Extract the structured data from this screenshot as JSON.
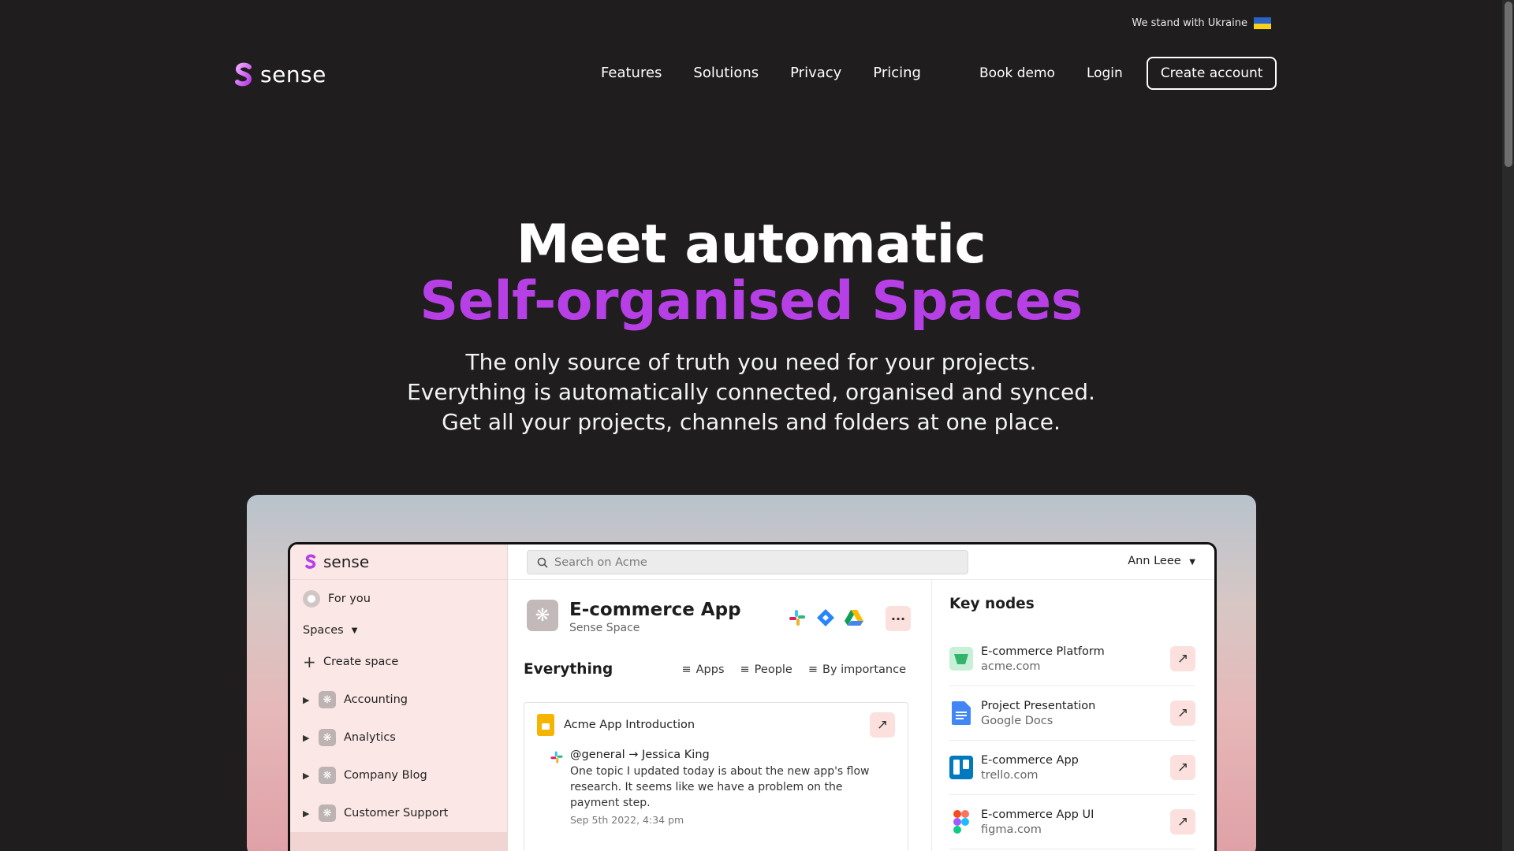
{
  "banner": {
    "text": "We stand with Ukraine"
  },
  "brand": {
    "name": "sense"
  },
  "nav": {
    "items": [
      "Features",
      "Solutions",
      "Privacy",
      "Pricing"
    ],
    "book_demo": "Book demo",
    "login": "Login",
    "create_account": "Create account"
  },
  "hero": {
    "title_line1": "Meet automatic",
    "title_line2": "Self-organised Spaces",
    "sub1": "The only source of truth you need for your projects.",
    "sub2": "Everything is automatically connected, organised and synced.",
    "sub3": "Get all your projects, channels and folders at one place."
  },
  "colors": {
    "accent": "#b640e6",
    "background": "#1f1d1d",
    "sidebar": "#fbe8e6"
  },
  "app": {
    "brand": "sense",
    "search_placeholder": "Search on Acme",
    "user": "Ann Leee",
    "sidebar": {
      "for_you": "For you",
      "spaces": "Spaces",
      "create_space": "Create space",
      "spaces_list": [
        "Accounting",
        "Analytics",
        "Company Blog",
        "Customer Support"
      ]
    },
    "project": {
      "title": "E-commerce App",
      "subtitle": "Sense Space"
    },
    "everything": "Everything",
    "filters": {
      "apps": "Apps",
      "people": "People",
      "importance": "By importance"
    },
    "card": {
      "title": "Acme App Introduction",
      "from": "@general → Jessica King",
      "text": "One topic I updated today is about the new app's flow research. It seems like we have a problem on the payment step.",
      "date": "Sep 5th 2022, 4:34 pm"
    },
    "key_nodes": {
      "title": "Key nodes",
      "items": [
        {
          "name": "E-commerce Platform",
          "url": "acme.com",
          "icon": "acme-icon"
        },
        {
          "name": "Project Presentation",
          "url": "Google Docs",
          "icon": "google-docs-icon"
        },
        {
          "name": "E-commerce App",
          "url": "trello.com",
          "icon": "trello-icon"
        },
        {
          "name": "E-commerce App UI",
          "url": "figma.com",
          "icon": "figma-icon"
        }
      ]
    }
  }
}
